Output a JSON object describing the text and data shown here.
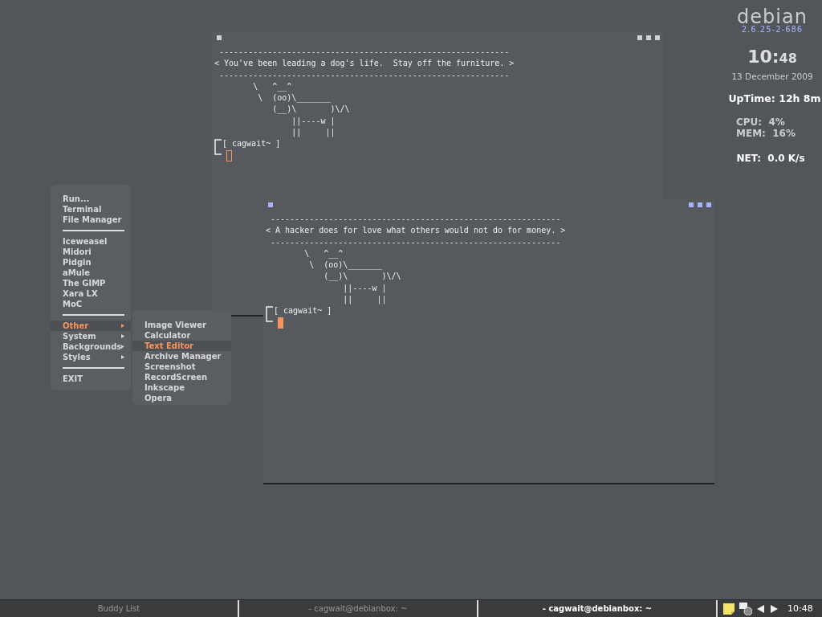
{
  "terminals": [
    {
      "active": false,
      "lines": [
        " ------------------------------------------------------------",
        "< You've been leading a dog's life.  Stay off the furniture. >",
        " ------------------------------------------------------------",
        "        \\   ^__^",
        "         \\  (oo)\\_______",
        "            (__)\\       )\\/\\",
        "                ||----w |",
        "                ||     ||"
      ],
      "prompt": "[ cagwait~ ]"
    },
    {
      "active": true,
      "lines": [
        " ------------------------------------------------------------",
        "< A hacker does for love what others would not do for money. >",
        " ------------------------------------------------------------",
        "        \\   ^__^",
        "         \\  (oo)\\_______",
        "            (__)\\       )\\/\\",
        "                ||----w |",
        "                ||     ||"
      ],
      "prompt": "[ cagwait~ ]"
    }
  ],
  "menu": {
    "items": [
      {
        "kind": "item",
        "label": "Run...",
        "selected": false
      },
      {
        "kind": "item",
        "label": "Terminal",
        "selected": false
      },
      {
        "kind": "item",
        "label": "File Manager",
        "selected": false
      },
      {
        "kind": "separator"
      },
      {
        "kind": "item",
        "label": "Iceweasel",
        "selected": false
      },
      {
        "kind": "item",
        "label": "Midori",
        "selected": false
      },
      {
        "kind": "item",
        "label": "Pidgin",
        "selected": false
      },
      {
        "kind": "item",
        "label": "aMule",
        "selected": false
      },
      {
        "kind": "item",
        "label": "The GIMP",
        "selected": false
      },
      {
        "kind": "item",
        "label": "Xara LX",
        "selected": false
      },
      {
        "kind": "item",
        "label": "MoC",
        "selected": false
      },
      {
        "kind": "separator"
      },
      {
        "kind": "submenu",
        "label": "Other",
        "selected": true,
        "children": [
          {
            "label": "Image Viewer",
            "selected": false
          },
          {
            "label": "Calculator",
            "selected": false
          },
          {
            "label": "Text Editor",
            "selected": true
          },
          {
            "label": "Archive Manager",
            "selected": false
          },
          {
            "label": "Screenshot",
            "selected": false
          },
          {
            "label": "RecordScreen",
            "selected": false
          },
          {
            "label": "Inkscape",
            "selected": false
          },
          {
            "label": "Opera",
            "selected": false
          }
        ]
      },
      {
        "kind": "submenu",
        "label": "System",
        "selected": false
      },
      {
        "kind": "submenu",
        "label": "Backgrounds",
        "selected": false
      },
      {
        "kind": "submenu",
        "label": "Styles",
        "selected": false
      },
      {
        "kind": "separator"
      },
      {
        "kind": "item",
        "label": "EXIT",
        "selected": false
      }
    ]
  },
  "conky": {
    "logo": "debian",
    "kernel": "2.6.25-2-686",
    "clock_hours": "10:",
    "clock_minutes": "48",
    "date": "13 December 2009",
    "uptime": "UpTime: 12h 8m",
    "cpu": "CPU:  4%",
    "mem": "MEM:  16%",
    "net": "NET:  0.0 K/s"
  },
  "taskbar": {
    "tasks": [
      {
        "label": "Buddy List",
        "selected": false
      },
      {
        "label": "- cagwait@debianbox: ~",
        "selected": false
      },
      {
        "label": "- cagwait@debianbox: ~",
        "selected": true
      }
    ],
    "clock": "10:48"
  }
}
